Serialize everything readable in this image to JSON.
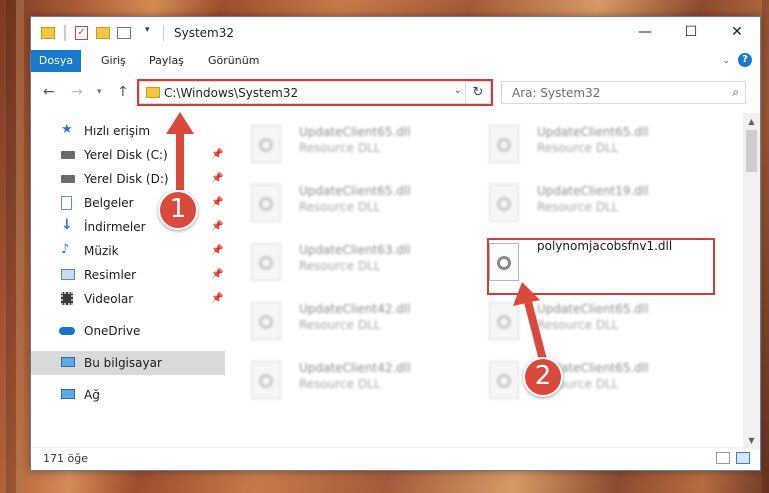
{
  "window": {
    "title": "System32",
    "controls": {
      "minimize": "—",
      "maximize": "☐",
      "close": "✕"
    }
  },
  "ribbon": {
    "tabs": [
      "Dosya",
      "Giriş",
      "Paylaş",
      "Görünüm"
    ],
    "help": "?"
  },
  "address_bar": {
    "path": "C:\\Windows\\System32"
  },
  "search": {
    "placeholder": "Ara: System32"
  },
  "sidebar": {
    "items": [
      {
        "label": "Hızlı erişim",
        "icon": "star-icon",
        "pinned": false,
        "selected": false
      },
      {
        "label": "Yerel Disk (C:)",
        "icon": "drive-icon",
        "pinned": true,
        "selected": false
      },
      {
        "label": "Yerel Disk (D:)",
        "icon": "drive-icon",
        "pinned": true,
        "selected": false
      },
      {
        "label": "Belgeler",
        "icon": "documents-icon",
        "pinned": true,
        "selected": false
      },
      {
        "label": "İndirmeler",
        "icon": "download-icon",
        "pinned": true,
        "selected": false
      },
      {
        "label": "Müzik",
        "icon": "music-icon",
        "pinned": true,
        "selected": false
      },
      {
        "label": "Resimler",
        "icon": "pictures-icon",
        "pinned": true,
        "selected": false
      },
      {
        "label": "Videolar",
        "icon": "video-icon",
        "pinned": true,
        "selected": false
      },
      {
        "label": "OneDrive",
        "icon": "cloud-icon",
        "pinned": false,
        "selected": false
      },
      {
        "label": "Bu bilgisayar",
        "icon": "computer-icon",
        "pinned": false,
        "selected": true
      },
      {
        "label": "Ağ",
        "icon": "network-icon",
        "pinned": false,
        "selected": false
      }
    ]
  },
  "files": [
    {
      "name": "UpdateClient65.dll",
      "desc": "Resource DLL"
    },
    {
      "name": "UpdateClient65.dll",
      "desc": "Resource DLL"
    },
    {
      "name": "UpdateClient65.dll",
      "desc": "Resource DLL"
    },
    {
      "name": "UpdateClient19.dll",
      "desc": "Resource DLL"
    },
    {
      "name": "UpdateClient63.dll",
      "desc": "Resource DLL"
    },
    {
      "name": "polynomjacobsfnv1.dll",
      "desc": ""
    },
    {
      "name": "UpdateClient42.dll",
      "desc": "Resource DLL"
    },
    {
      "name": "UpdateClient65.dll",
      "desc": "Resource DLL"
    },
    {
      "name": "UpdateClient42.dll",
      "desc": "Resource DLL"
    },
    {
      "name": "UpdateClient65.dll",
      "desc": "Resource DLL"
    }
  ],
  "status": {
    "item_count": "171 öğe"
  },
  "annotations": {
    "step1": "1",
    "step2": "2",
    "color": "#d33a3a"
  }
}
